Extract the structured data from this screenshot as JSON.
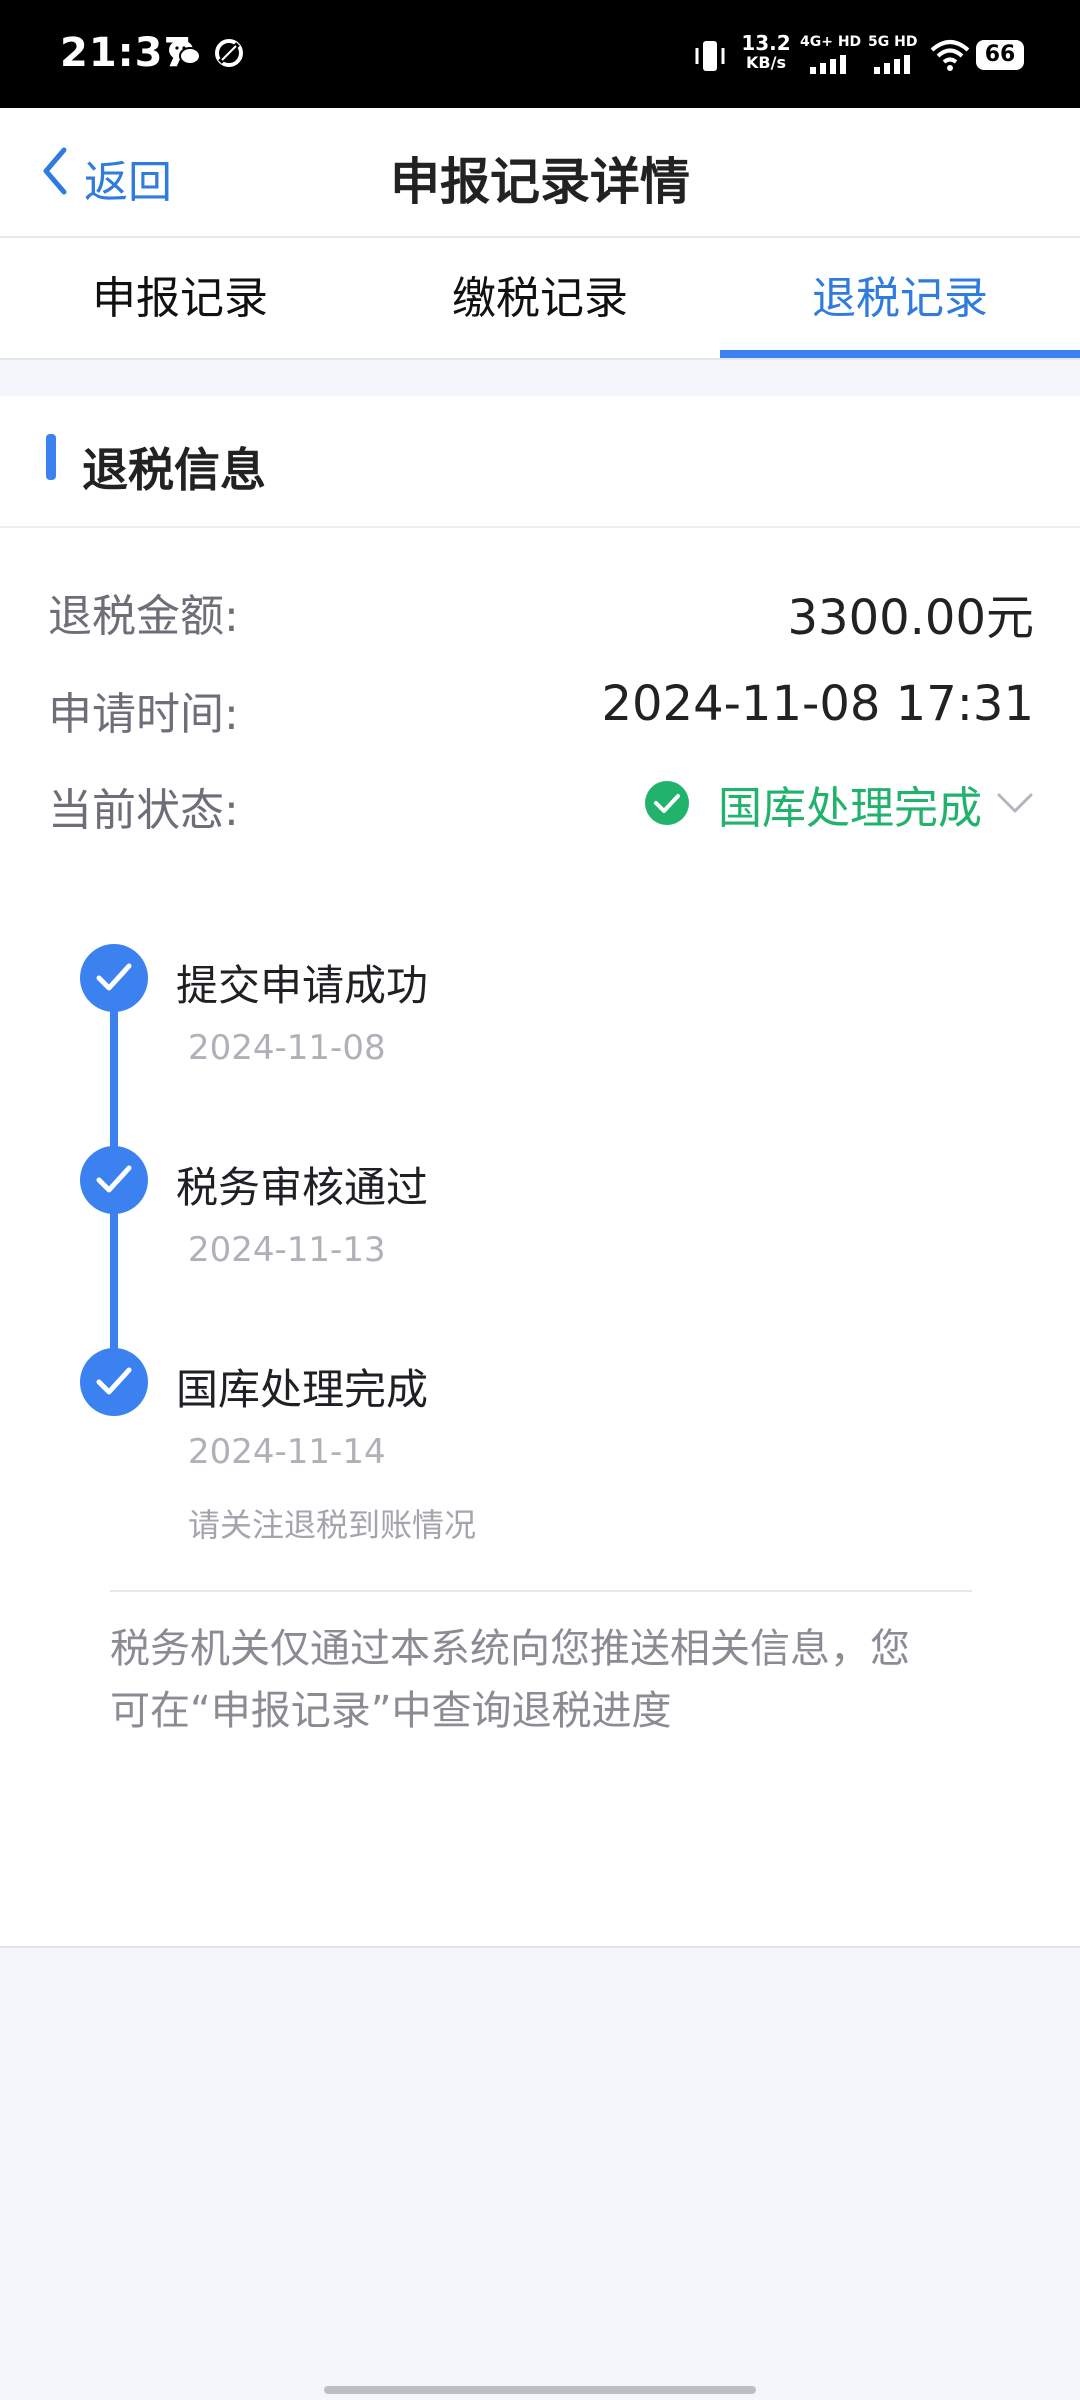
{
  "status_bar": {
    "time": "21:37",
    "network_speed_value": "13.2",
    "network_speed_unit": "KB/s",
    "sim1_label": "4G+ HD",
    "sim2_label": "5G HD",
    "battery": "66",
    "icons": [
      "wechat-icon",
      "app-notification-icon",
      "vibrate-icon",
      "signal-icon",
      "wifi-icon",
      "battery-icon"
    ]
  },
  "nav": {
    "back_label": "返回",
    "title": "申报记录详情"
  },
  "tabs": [
    {
      "label": "申报记录",
      "active": false
    },
    {
      "label": "缴税记录",
      "active": false
    },
    {
      "label": "退税记录",
      "active": true
    }
  ],
  "section": {
    "title": "退税信息"
  },
  "info": {
    "amount_label": "退税金额:",
    "amount_value": "3300.00元",
    "time_label": "申请时间:",
    "time_value": "2024-11-08 17:31",
    "status_label": "当前状态:",
    "status_value": "国库处理完成"
  },
  "timeline": [
    {
      "title": "提交申请成功",
      "date": "2024-11-08"
    },
    {
      "title": "税务审核通过",
      "date": "2024-11-13"
    },
    {
      "title": "国库处理完成",
      "date": "2024-11-14",
      "note": "请关注退税到账情况"
    }
  ],
  "notice": {
    "line1": "税务机关仅通过本系统向您推送相关信息，您",
    "line2": "可在“申报记录”中查询退税进度"
  },
  "colors": {
    "accent": "#2f7be0",
    "success": "#21b26c",
    "background": "#f5f6fb"
  }
}
